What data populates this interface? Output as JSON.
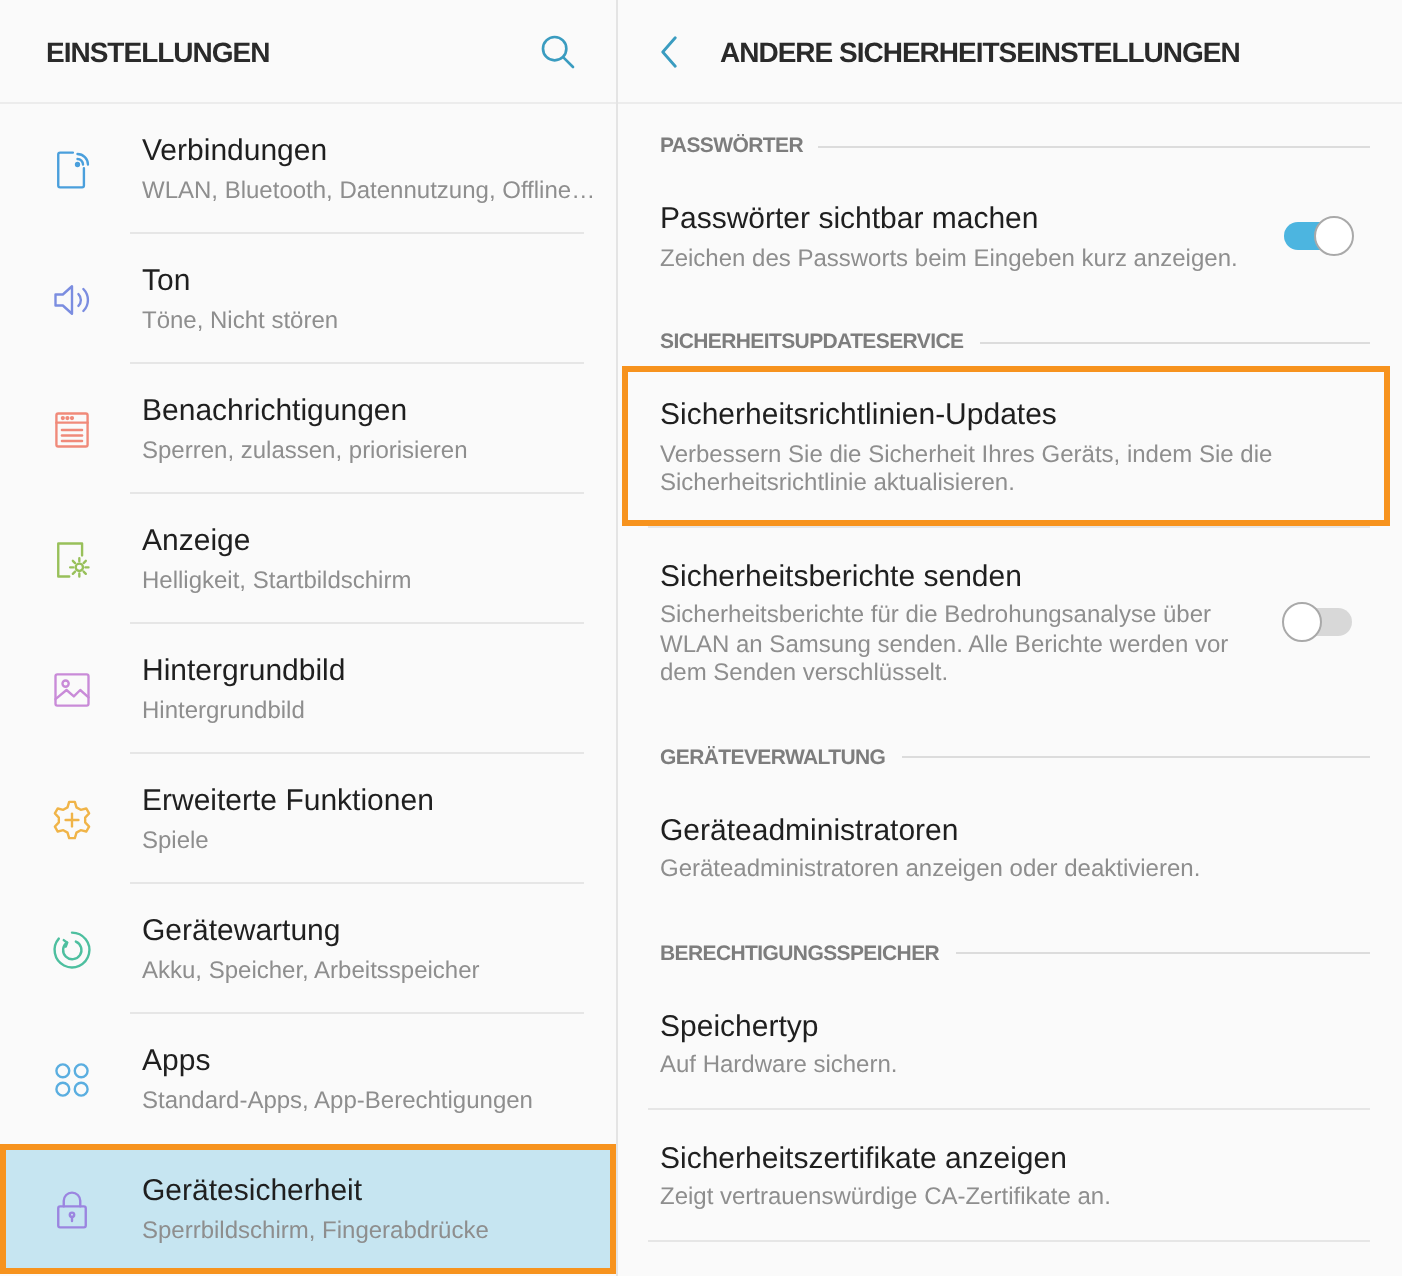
{
  "left_panel": {
    "title": "EINSTELLUNGEN",
    "items": [
      {
        "title": "Verbindungen",
        "subtitle": "WLAN, Bluetooth, Datennutzung, Offline…",
        "selected": false,
        "highlighted": false
      },
      {
        "title": "Ton",
        "subtitle": "Töne, Nicht stören",
        "selected": false,
        "highlighted": false
      },
      {
        "title": "Benachrichtigungen",
        "subtitle": "Sperren, zulassen, priorisieren",
        "selected": false,
        "highlighted": false
      },
      {
        "title": "Anzeige",
        "subtitle": "Helligkeit, Startbildschirm",
        "selected": false,
        "highlighted": false
      },
      {
        "title": "Hintergrundbild",
        "subtitle": "Hintergrundbild",
        "selected": false,
        "highlighted": false
      },
      {
        "title": "Erweiterte Funktionen",
        "subtitle": "Spiele",
        "selected": false,
        "highlighted": false
      },
      {
        "title": "Gerätewartung",
        "subtitle": "Akku, Speicher, Arbeitsspeicher",
        "selected": false,
        "highlighted": false
      },
      {
        "title": "Apps",
        "subtitle": "Standard-Apps, App-Berechtigungen",
        "selected": false,
        "highlighted": false
      },
      {
        "title": "Gerätesicherheit",
        "subtitle": "Sperrbildschirm, Fingerabdrücke",
        "selected": true,
        "highlighted": true
      }
    ]
  },
  "right_panel": {
    "title": "ANDERE SICHERHEITSEINSTELLUNGEN",
    "sections": [
      {
        "title": "PASSWÖRTER",
        "rows": [
          {
            "kind": "toggle",
            "title": "Passwörter sichtbar machen",
            "description": "Zeichen des Passworts beim Eingeben kurz anzeigen.",
            "on": true,
            "highlighted": false
          }
        ]
      },
      {
        "title": "SICHERHEITSUPDATESERVICE",
        "rows": [
          {
            "kind": "plain",
            "title": "Sicherheitsrichtlinien-Updates",
            "description": "Verbessern Sie die Sicherheit Ihres Geräts, indem Sie die Sicherheitsrichtlinie aktualisieren.",
            "highlighted": true
          },
          {
            "kind": "toggle",
            "title": "Sicherheitsberichte senden",
            "description": "Sicherheitsberichte für die Bedrohungsanalyse über WLAN an Samsung senden. Alle Berichte werden vor dem Senden verschlüsselt.",
            "on": false,
            "highlighted": false
          }
        ]
      },
      {
        "title": "GERÄTEVERWALTUNG",
        "rows": [
          {
            "kind": "plain",
            "title": "Geräteadministratoren",
            "description": "Geräteadministratoren anzeigen oder deaktivieren.",
            "highlighted": false
          }
        ]
      },
      {
        "title": "BERECHTIGUNGSSPEICHER",
        "rows": [
          {
            "kind": "plain",
            "title": "Speichertyp",
            "description": "Auf Hardware sichern.",
            "highlighted": false
          },
          {
            "kind": "plain",
            "title": "Sicherheitszertifikate anzeigen",
            "description": "Zeigt vertrauenswürdige CA-Zertifikate an.",
            "highlighted": false
          }
        ]
      }
    ]
  }
}
